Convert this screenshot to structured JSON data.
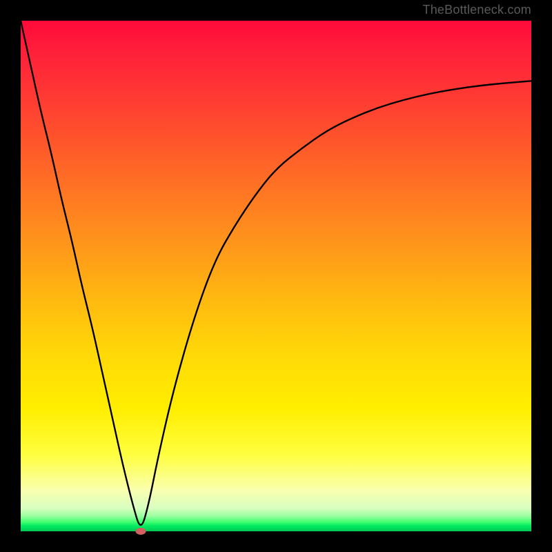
{
  "attribution": "TheBottleneck.com",
  "colors": {
    "frame": "#000000",
    "gradient_top": "#ff0a3a",
    "gradient_mid": "#ffee00",
    "gradient_bottom": "#00c850",
    "curve": "#000000",
    "marker": "#cf6161"
  },
  "chart_data": {
    "type": "line",
    "title": "",
    "xlabel": "",
    "ylabel": "",
    "xlim": [
      0,
      100
    ],
    "ylim": [
      0,
      100
    ],
    "series": [
      {
        "name": "bottleneck-curve",
        "x": [
          0,
          2,
          4,
          6,
          8,
          10,
          12,
          14,
          16,
          18,
          20,
          22,
          23.5,
          25,
          27,
          30,
          34,
          38,
          42,
          46,
          50,
          55,
          60,
          65,
          70,
          75,
          80,
          85,
          90,
          95,
          100
        ],
        "y": [
          100,
          91,
          82,
          74,
          65,
          57,
          48,
          40,
          31,
          22,
          13,
          5,
          0,
          5,
          15,
          28,
          42,
          53,
          60,
          66,
          71,
          75,
          78.5,
          81,
          83,
          84.5,
          85.7,
          86.6,
          87.3,
          87.8,
          88.2
        ]
      }
    ],
    "marker": {
      "x": 23.5,
      "y": 0
    },
    "grid": false,
    "legend": false
  }
}
